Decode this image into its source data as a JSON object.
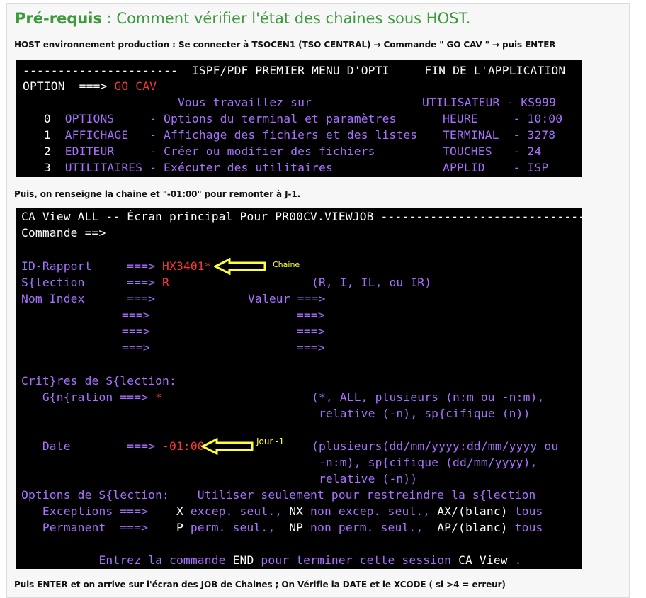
{
  "heading": {
    "bold": "Pré-requis",
    "rest": " : Comment vérifier l'état des chaines sous HOST."
  },
  "captions": {
    "c1": "HOST environnement production : Se connecter à TSOCEN1 (TSO CENTRAL) → Commande \" GO CAV \" →  puis ENTER",
    "c2": "Puis, on renseigne la chaine et \"-01:00\" pour remonter à J-1.",
    "c3": "Puis ENTER et on arrive sur l'écran des JOB de Chaines ; On Vérifie la DATE et le XCODE ( si >4 = erreur)"
  },
  "ispf": {
    "title_line": "----------------------  ISPF/PDF PREMIER MENU D'OPTI     FIN DE L'APPLICATION",
    "option_label": "OPTION  ===> ",
    "option_value": "GO CAV",
    "vous": "                      Vous travaillez sur",
    "user_label": "UTILISATEUR - KS999",
    "menu": [
      {
        "num": "   0  ",
        "name": "OPTIONS     ",
        "desc": "- Options du terminal et paramètres",
        "info": "HEURE     - 10:00"
      },
      {
        "num": "   1  ",
        "name": "AFFICHAGE   ",
        "desc": "- Affichage des fichiers et des listes",
        "info": "TERMINAL  - 3278"
      },
      {
        "num": "   2  ",
        "name": "EDITEUR     ",
        "desc": "- Créer ou modifier des fichiers",
        "info": "TOUCHES   - 24"
      },
      {
        "num": "   3  ",
        "name": "UTILITAIRES ",
        "desc": "- Exécuter des utilitaires",
        "info": "APPLID    - ISP"
      }
    ]
  },
  "cav": {
    "title_line": "CA View ALL -- Écran principal Pour PR00CV.VIEWJOB ------------------------------",
    "command": "Commande ==>",
    "id_rapport_label": "ID-Rapport     ===> ",
    "id_rapport_value": "HX3401*",
    "selection_label": "S{lection      ===> ",
    "selection_value": "R",
    "selection_hint": "(R, I, IL, ou IR)",
    "nom_index": "Nom Index      ===>",
    "valeur": "Valeur ===>",
    "arrow_sym": "===>",
    "criteres": "Crit}res de S{lection:",
    "generation_label": "   G{n{ration ===> ",
    "generation_value": "*",
    "generation_hint1": "(*, ALL, plusieurs (n:m ou -n:m),",
    "generation_hint2": " relative (-n), sp{cifique (n))",
    "date_label": "   Date        ===> ",
    "date_value": "-01:00",
    "date_hint1": "(plusieurs(dd/mm/yyyy:dd/mm/yyyy ou",
    "date_hint2": " -n:m), sp{cifique (dd/mm/yyyy),",
    "date_hint3": " relative (-n))",
    "options_label": "Options de S{lection:    Utiliser seulement pour restreindre la s{lection",
    "exceptions_label": "   Exceptions ===>    ",
    "exceptions": {
      "k1": "X",
      "t1": " excep. seul., ",
      "k2": "NX",
      "t2": " non excep. seul., ",
      "k3": "AX/(blanc)",
      "t3": " tous"
    },
    "permanent_label": "   Permanent  ===>    ",
    "permanent": {
      "k1": "P",
      "t1": " perm. seul.,  ",
      "k2": "NP",
      "t2": " non perm. seul.,  ",
      "k3": "AP/(blanc)",
      "t3": " tous"
    },
    "footer": {
      "a": "           Entrez la commande ",
      "b": "END",
      "c": " pour terminer cette session ",
      "d": "CA View",
      "e": " ."
    }
  },
  "annotations": {
    "chaine": "Chaine",
    "jour": "Jour -1"
  },
  "colors": {
    "heading": "#3d9a3d",
    "terminal_bg": "#000000",
    "purple": "#a870ff",
    "red": "#ff3434",
    "yellow": "#ffff33"
  }
}
